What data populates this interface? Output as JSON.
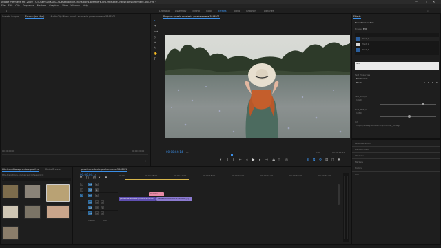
{
  "titlebar": {
    "text": "Adobe Premiere Pro 2020 - C:\\Users\\DiMAGCO\\Desktop\\title-transitions-premiere-pro-free\\title-transitions-premiere-pro-free *",
    "min": "—",
    "max": "□",
    "close": "✕"
  },
  "menubar": {
    "items": [
      "File",
      "Edit",
      "Clip",
      "Sequence",
      "Markers",
      "Graphics",
      "View",
      "Window",
      "Help"
    ]
  },
  "workspaces": {
    "tabs": [
      "Learning",
      "Assembly",
      "Editing",
      "Color",
      "Effects",
      "Audio",
      "Graphics",
      "Libraries"
    ],
    "active_index": 4
  },
  "source_panel": {
    "tabs": [
      "Lumetri Scopes",
      "Source: (no clips)",
      "Audio Clip Mixer: pexels-anastasia-goreharsmeva-5846501"
    ],
    "active_index": 1,
    "timecode_left": "00:00:00:00",
    "timecode_right": "00:00:00:00"
  },
  "program_panel": {
    "title": "Program: pexels-anastasia-goreharsmeva-5846501",
    "timecode": "00:00:04:14",
    "fit": "Fit",
    "quality": "Full",
    "duration": "00:00:11:15"
  },
  "project_panel": {
    "tabs": [
      "title-transitions-premiere-pro-free",
      "Media Browser"
    ],
    "path": "title-transitions-premiere-pro-free.prproj",
    "clips": [
      {
        "color": "#7d6c4c"
      },
      {
        "color": "#8a8378"
      },
      {
        "color": "#b9a274"
      },
      {
        "color": "#cfc6b4"
      },
      {
        "color": "#7b7466"
      },
      {
        "color": "#c9a58b"
      },
      {
        "color": "#8b7d6a"
      }
    ]
  },
  "timeline_panel": {
    "tab": "pexels-anastasia-goreharsmeva-5846501",
    "timecode": "00:00:04:14",
    "ruler": [
      "00:00",
      "00:00:05:00",
      "00:00:10:00",
      "00:00:15:00",
      "00:00:20:00",
      "00:00:25:00",
      "00:00:30:00",
      "00:00:35:00"
    ],
    "tracks": [
      "V3",
      "V2",
      "V1",
      "A1",
      "A2",
      "A3",
      "Master"
    ],
    "master_value": "0.0",
    "graphic_clip": "Graphic",
    "video_clip": "pexels-anastasia-goreharsmeva-5846501.mp4 [V]",
    "video_clip2": "pexels-cottonbro-5544954 [V]",
    "colors": {
      "graphic": "#e88aa6",
      "video": "#8b7ad0",
      "video_selected": "#5f4fb1"
    }
  },
  "effects_panel": {
    "tab": "Effects",
    "section": "Essential Graphics",
    "subtabs": [
      "Browse",
      "Edit"
    ],
    "layers": [
      "Text_1",
      "Text_2",
      "Text_3"
    ],
    "text_field": "Text",
    "text_value": "",
    "section2": "Text Properties",
    "font": "Montserrat",
    "style": "Black",
    "buttons": [
      "T",
      "T",
      "T",
      "T"
    ],
    "sliders": [
      {
        "label": "Text_POS_X",
        "value": "1920"
      },
      {
        "label": "Text_POS_Y",
        "value": "1080"
      }
    ],
    "url_label": "Url",
    "url_value": "https://www.youtube.com/channel_dimagi",
    "lower_sections": [
      "Essential Sound",
      "Lumetri Color",
      "Libraries",
      "Markers",
      "History",
      "Info"
    ]
  }
}
